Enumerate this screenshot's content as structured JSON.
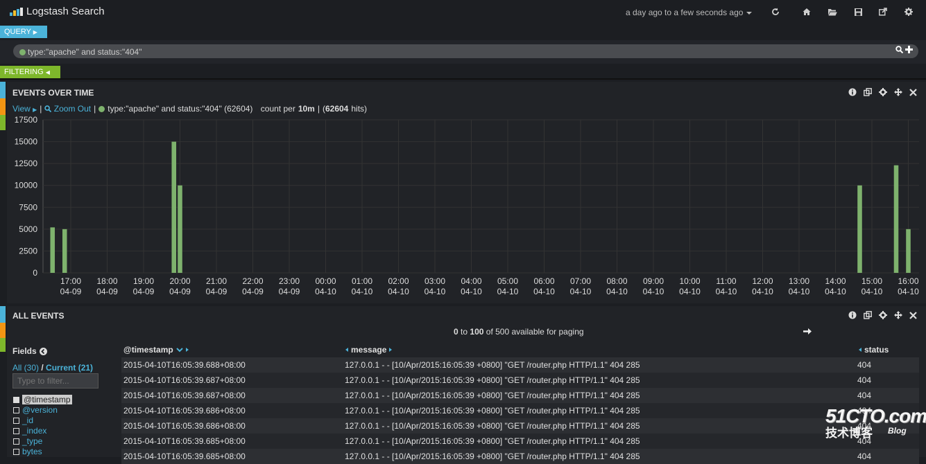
{
  "app": {
    "title": "Logstash Search"
  },
  "header": {
    "time_range": "a day ago to a few seconds ago"
  },
  "query": {
    "tag_label": "QUERY",
    "text": "type:\"apache\" and status:\"404\"",
    "color": "#7eb26d"
  },
  "filtering": {
    "tag_label": "FILTERING"
  },
  "histogram": {
    "title": "EVENTS OVER TIME",
    "view_label": "View",
    "zoom_out_label": "Zoom Out",
    "legend_query": "type:\"apache\" and status:\"404\" (62604)",
    "count_per_prefix": "count per",
    "interval": "10m",
    "hits": "62604",
    "hits_suffix": "hits)"
  },
  "chart_data": {
    "type": "bar",
    "ylim": [
      0,
      17500
    ],
    "y_ticks": [
      0,
      2500,
      5000,
      7500,
      10000,
      12500,
      15000,
      17500
    ],
    "x_ticks": [
      [
        "17:00",
        "04-09"
      ],
      [
        "18:00",
        "04-09"
      ],
      [
        "19:00",
        "04-09"
      ],
      [
        "20:00",
        "04-09"
      ],
      [
        "21:00",
        "04-09"
      ],
      [
        "22:00",
        "04-09"
      ],
      [
        "23:00",
        "04-09"
      ],
      [
        "00:00",
        "04-10"
      ],
      [
        "01:00",
        "04-10"
      ],
      [
        "02:00",
        "04-10"
      ],
      [
        "03:00",
        "04-10"
      ],
      [
        "04:00",
        "04-10"
      ],
      [
        "05:00",
        "04-10"
      ],
      [
        "06:00",
        "04-10"
      ],
      [
        "07:00",
        "04-10"
      ],
      [
        "08:00",
        "04-10"
      ],
      [
        "09:00",
        "04-10"
      ],
      [
        "10:00",
        "04-10"
      ],
      [
        "11:00",
        "04-10"
      ],
      [
        "12:00",
        "04-10"
      ],
      [
        "13:00",
        "04-10"
      ],
      [
        "14:00",
        "04-10"
      ],
      [
        "15:00",
        "04-10"
      ],
      [
        "16:00",
        "04-10"
      ]
    ],
    "series": [
      {
        "color": "#7eb26d",
        "points": [
          {
            "time": "04-09 16:30",
            "count": 5200
          },
          {
            "time": "04-09 16:50",
            "count": 5000
          },
          {
            "time": "04-09 19:50",
            "count": 15000
          },
          {
            "time": "04-09 20:00",
            "count": 10000
          },
          {
            "time": "04-10 14:40",
            "count": 10000
          },
          {
            "time": "04-10 15:40",
            "count": 12300
          },
          {
            "time": "04-10 16:00",
            "count": 5000
          }
        ]
      }
    ],
    "grid": true,
    "bar_color": "#7eb26d"
  },
  "events": {
    "title": "ALL EVENTS",
    "paging_from": "0",
    "paging_to_word": "to",
    "paging_to": "100",
    "paging_suffix": "of 500 available for paging",
    "fields_title": "Fields",
    "fields_all": "All (30)",
    "fields_current": "Current (21)",
    "filter_placeholder": "Type to filter...",
    "field_list": [
      {
        "name": "@timestamp",
        "checked": true
      },
      {
        "name": "@version",
        "checked": false
      },
      {
        "name": "_id",
        "checked": false
      },
      {
        "name": "_index",
        "checked": false
      },
      {
        "name": "_type",
        "checked": false
      },
      {
        "name": "bytes",
        "checked": false
      }
    ],
    "columns": [
      "@timestamp",
      "message",
      "status"
    ],
    "rows": [
      [
        "2015-04-10T16:05:39.688+08:00",
        "127.0.0.1 - - [10/Apr/2015:16:05:39 +0800] \"GET /router.php HTTP/1.1\" 404 285",
        "404"
      ],
      [
        "2015-04-10T16:05:39.687+08:00",
        "127.0.0.1 - - [10/Apr/2015:16:05:39 +0800] \"GET /router.php HTTP/1.1\" 404 285",
        "404"
      ],
      [
        "2015-04-10T16:05:39.687+08:00",
        "127.0.0.1 - - [10/Apr/2015:16:05:39 +0800] \"GET /router.php HTTP/1.1\" 404 285",
        "404"
      ],
      [
        "2015-04-10T16:05:39.686+08:00",
        "127.0.0.1 - - [10/Apr/2015:16:05:39 +0800] \"GET /router.php HTTP/1.1\" 404 285",
        "404"
      ],
      [
        "2015-04-10T16:05:39.686+08:00",
        "127.0.0.1 - - [10/Apr/2015:16:05:39 +0800] \"GET /router.php HTTP/1.1\" 404 285",
        "404"
      ],
      [
        "2015-04-10T16:05:39.685+08:00",
        "127.0.0.1 - - [10/Apr/2015:16:05:39 +0800] \"GET /router.php HTTP/1.1\" 404 285",
        "404"
      ],
      [
        "2015-04-10T16:05:39.685+08:00",
        "127.0.0.1 - - [10/Apr/2015:16:05:39 +0800] \"GET /router.php HTTP/1.1\" 404 285",
        "404"
      ]
    ]
  },
  "watermark": {
    "line1": "51CTO.com",
    "line2": "技术博客",
    "line3": "Blog"
  },
  "colors": {
    "accent_blue": "#4bb3d9",
    "accent_green": "#7eb72b",
    "orange": "#f29513",
    "bar": "#7eb26d"
  }
}
